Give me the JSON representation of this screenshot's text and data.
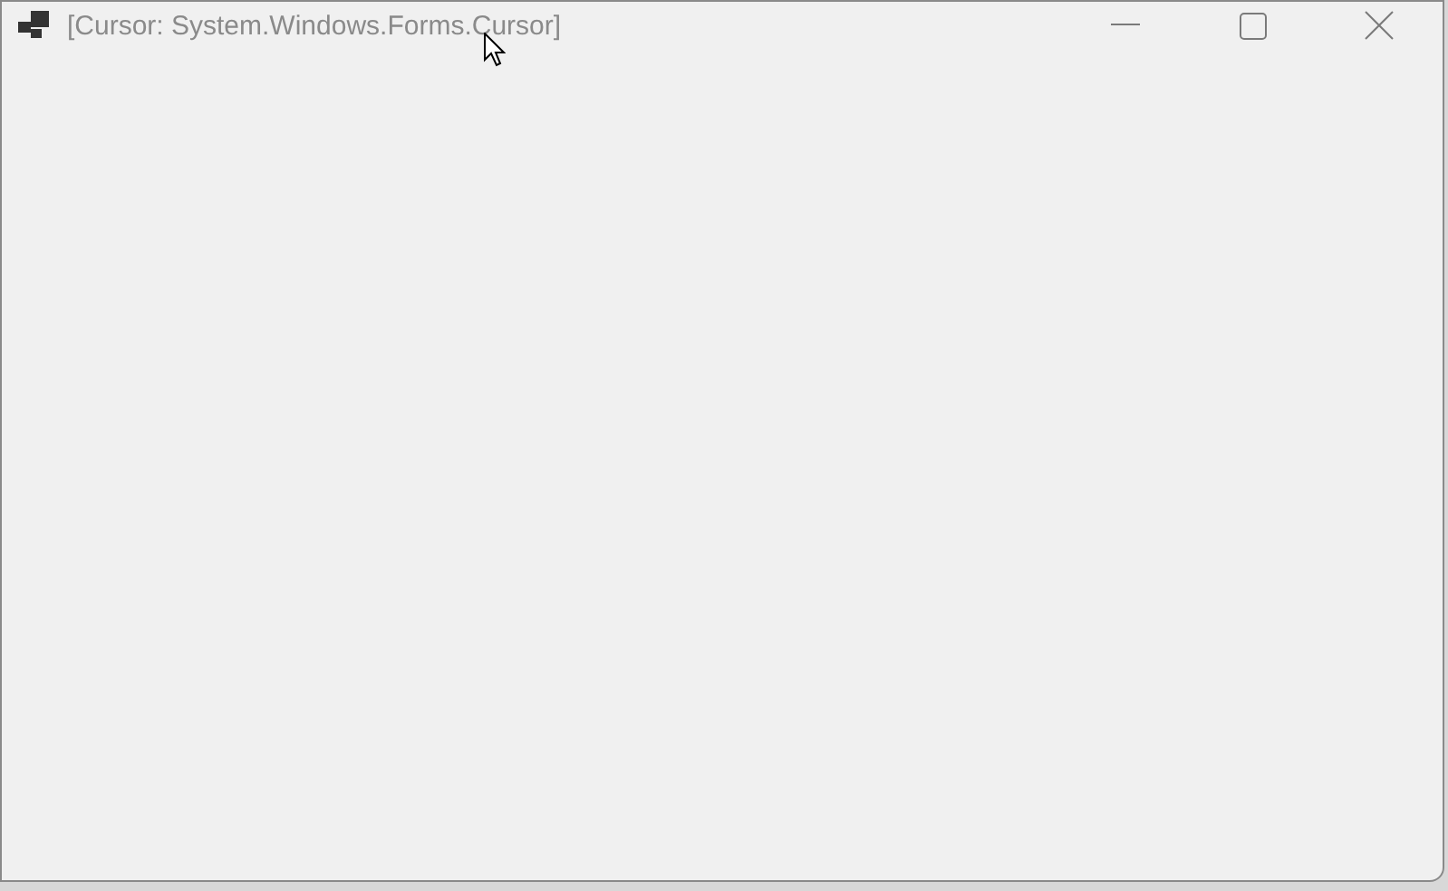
{
  "window": {
    "title": "[Cursor: System.Windows.Forms.Cursor]",
    "active": false
  }
}
